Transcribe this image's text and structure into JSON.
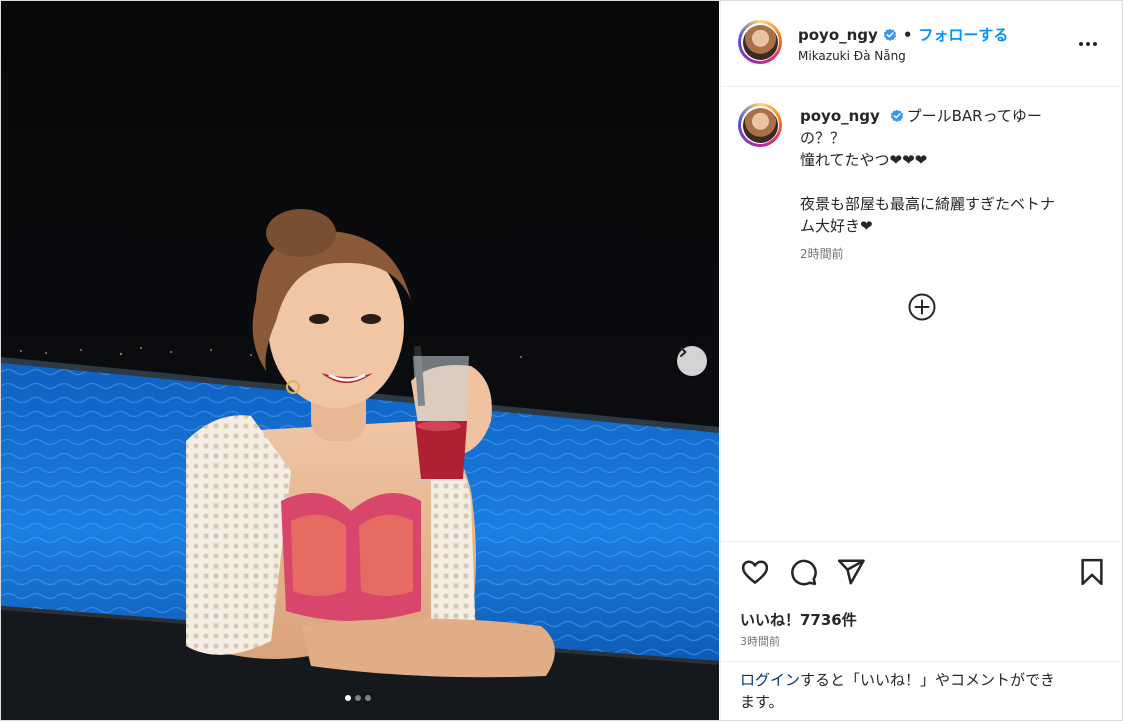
{
  "post": {
    "username": "poyo_ngy",
    "follow_label": "フォローする",
    "separator": "•",
    "location": "Mikazuki Đà Nẵng",
    "more_icon": "more-horizontal-icon",
    "verified_icon": "verified-badge-icon",
    "verified_color": "#3897f0",
    "accent_color": "#0095f6"
  },
  "caption": {
    "username": "poyo_ngy",
    "lines": [
      "プールBARってゆー",
      "の？？",
      "憧れてたやつ❤︎❤︎❤︎",
      "",
      "夜景も部屋も最高に綺麗すぎたベトナ",
      "ム大好き❤︎"
    ],
    "time": "2時間前"
  },
  "comment_expand_icon": "plus-circle-icon",
  "actions": {
    "like_icon": "heart-icon",
    "comment_icon": "comment-icon",
    "share_icon": "send-icon",
    "save_icon": "bookmark-icon"
  },
  "stats": {
    "likes": "いいね！7736件",
    "time": "3時間前"
  },
  "login_prompt": {
    "link": "ログイン",
    "line1_rest": "すると「いいね！」やコメントができ",
    "line2": "ます。"
  },
  "carousel": {
    "next_icon": "chevron-right-icon",
    "total": 3,
    "current": 1
  }
}
